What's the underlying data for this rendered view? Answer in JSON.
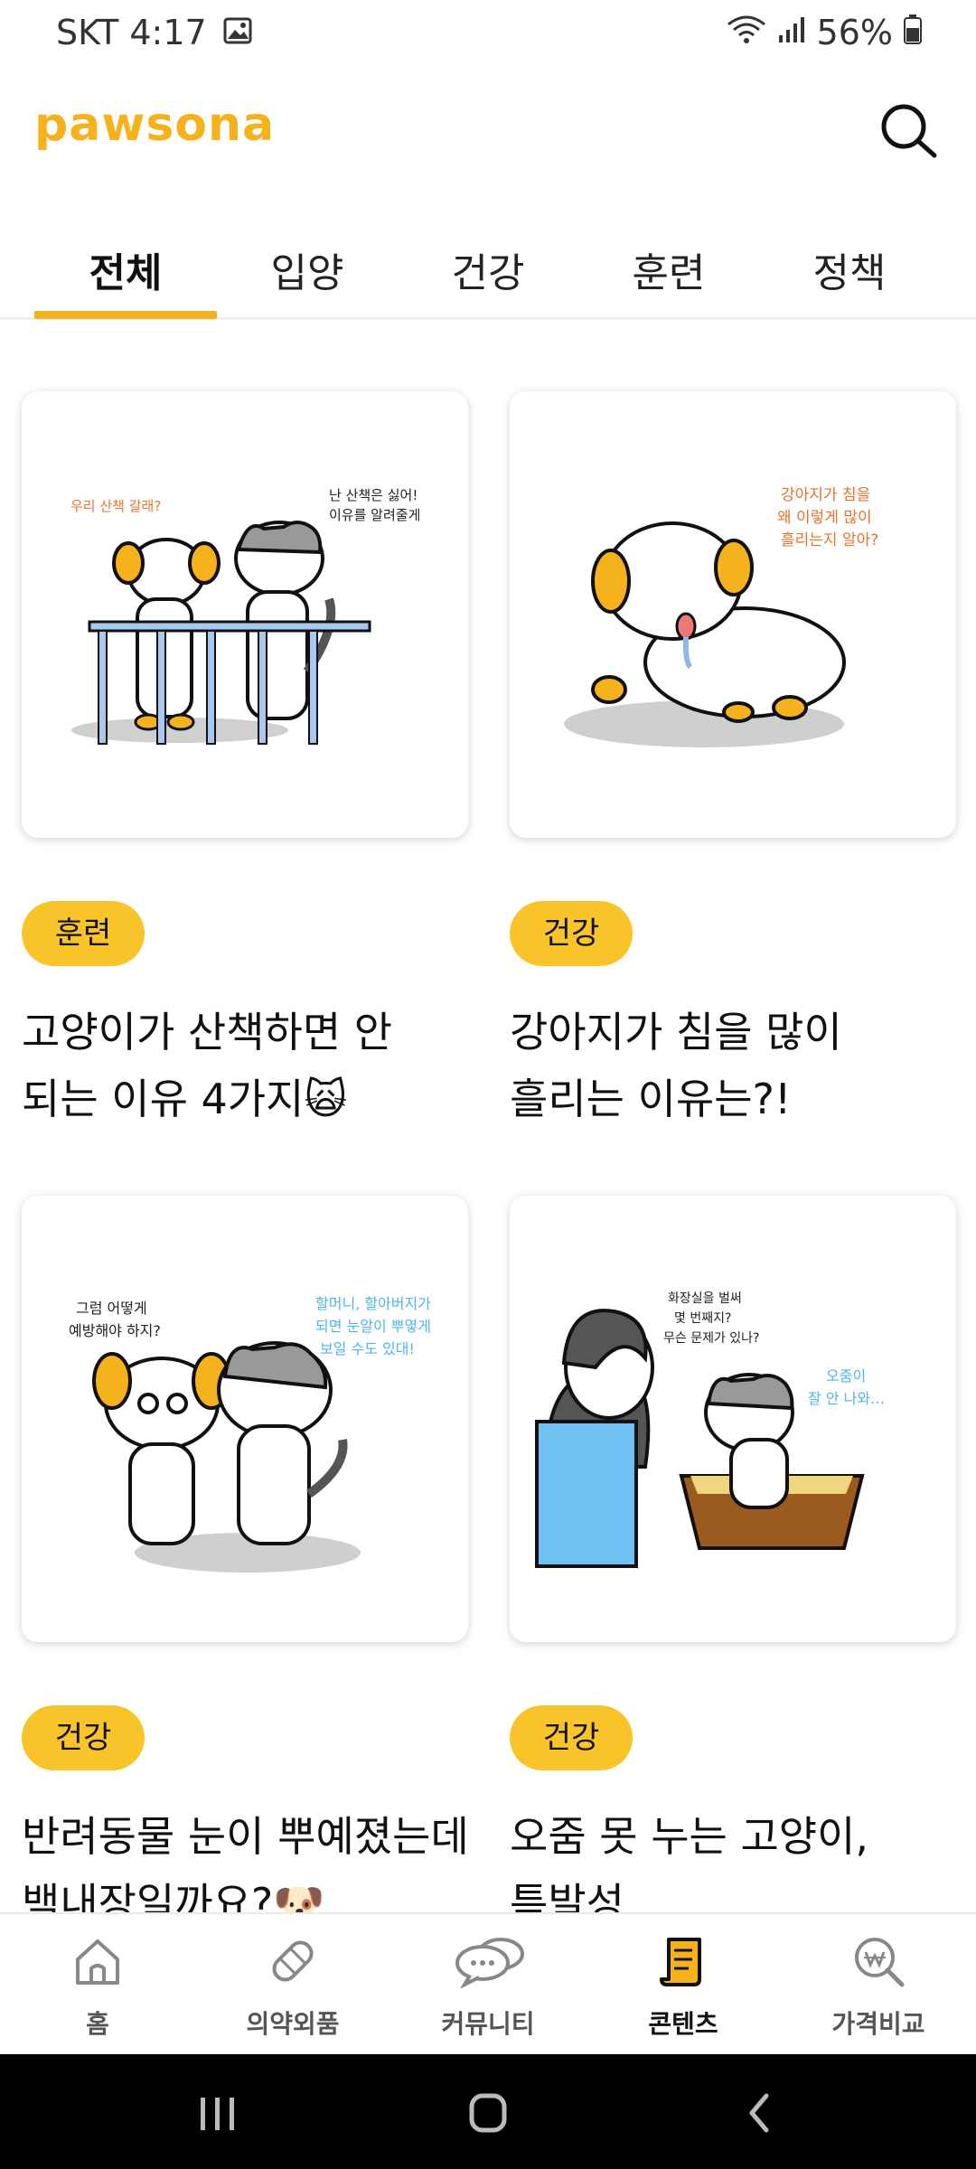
{
  "status_bar": {
    "carrier_time": "SKT 4:17",
    "battery": "56%"
  },
  "header": {
    "logo": "pawsona",
    "accent_color": "#f6b21d"
  },
  "tabs": [
    {
      "label": "전체",
      "active": true
    },
    {
      "label": "입양",
      "active": false
    },
    {
      "label": "건강",
      "active": false
    },
    {
      "label": "훈련",
      "active": false
    },
    {
      "label": "정책",
      "active": false
    }
  ],
  "cards": [
    {
      "tag": "훈련",
      "title_line1": "고양이가 산책하면 안",
      "title_line2": "되는 이유 4가지🙀",
      "bubble_left": "우리 산책 갈래?",
      "bubble_right_1": "난 산책은 싫어!",
      "bubble_right_2": "이유를 알려줄게"
    },
    {
      "tag": "건강",
      "title_line1": "강아지가 침을 많이",
      "title_line2": "흘리는 이유는?!",
      "bubble_1": "강아지가 침을",
      "bubble_2": "왜 이렇게 많이",
      "bubble_3": "흘리는지 알아?"
    },
    {
      "tag": "건강",
      "title_line1": "반려동물 눈이 뿌예졌는데",
      "title_line2": "백내장일까요?🐶",
      "bubble_left_1": "그럼 어떻게",
      "bubble_left_2": "예방해야 하지?",
      "bubble_right_1": "할머니, 할아버지가",
      "bubble_right_2": "되면 눈알이 뿌옇게",
      "bubble_right_3": "보일 수도 있대!"
    },
    {
      "tag": "건강",
      "title_line1": "오줌 못 누는 고양이,",
      "title_line2": "특발성…",
      "bubble_left_1": "화장실을 벌써",
      "bubble_left_2": "몇 번째지?",
      "bubble_left_3": "무슨 문제가 있나?",
      "bubble_right_1": "오줌이",
      "bubble_right_2": "잘 안 나와…"
    }
  ],
  "bottom_nav": [
    {
      "label": "홈",
      "icon": "home-icon"
    },
    {
      "label": "의약외품",
      "icon": "bandage-icon"
    },
    {
      "label": "커뮤니티",
      "icon": "chat-bubbles-icon"
    },
    {
      "label": "콘텐츠",
      "icon": "scroll-icon",
      "active": true
    },
    {
      "label": "가격비교",
      "icon": "price-search-icon"
    }
  ]
}
